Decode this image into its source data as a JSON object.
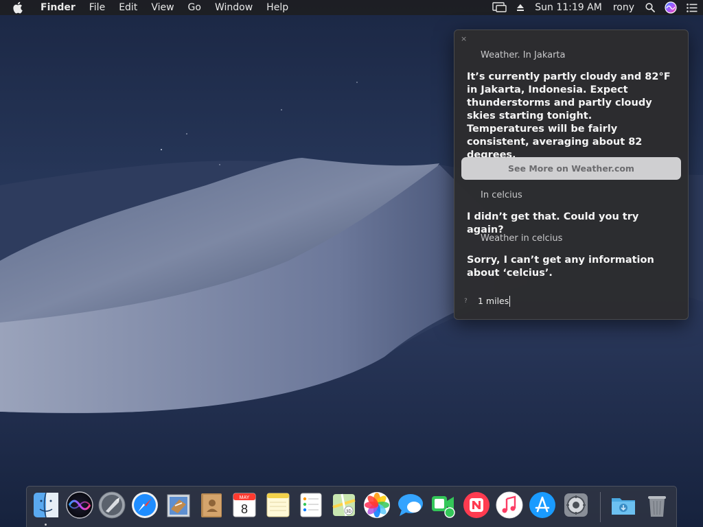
{
  "menubar": {
    "app_name": "Finder",
    "menus": [
      "File",
      "Edit",
      "View",
      "Go",
      "Window",
      "Help"
    ],
    "clock": "Sun 11:19 AM",
    "user": "rony"
  },
  "siri": {
    "close_glyph": "×",
    "conversation": [
      {
        "query": "Weather. In Jakarta",
        "answer": "It’s currently partly cloudy and 82°F in Jakarta, Indonesia. Expect thunderstorms and partly cloudy skies starting tonight. Temperatures will be fairly consistent, averaging about 82 degrees."
      },
      {
        "query": "In celcius",
        "answer": "I didn’t get that. Could you try again?"
      },
      {
        "query": "Weather in celcius",
        "answer": "Sorry, I can’t get any information about ‘celcius’."
      }
    ],
    "more_button": "See More on Weather.com",
    "help_glyph": "?",
    "input_text": "1 miles"
  },
  "calendar": {
    "month": "MAY",
    "day": "8"
  },
  "colors": {
    "accent_siri": "#7a5cff",
    "button_bg": "#cfcfd1"
  },
  "dock_icons": [
    "finder-icon",
    "siri-icon",
    "launchpad-icon",
    "safari-icon",
    "mail-icon",
    "contacts-icon",
    "calendar-icon",
    "notes-icon",
    "reminders-icon",
    "maps-icon",
    "photos-icon",
    "messages-icon",
    "facetime-icon",
    "news-icon",
    "itunes-icon",
    "app-store-icon",
    "system-preferences-icon",
    "downloads-folder-icon",
    "trash-icon"
  ]
}
